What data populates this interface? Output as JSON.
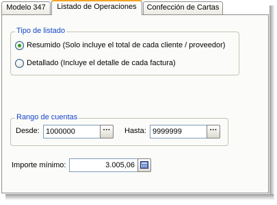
{
  "tabs": [
    {
      "label": "Modelo 347",
      "active": false
    },
    {
      "label": "Listado de Operaciones",
      "active": true
    },
    {
      "label": "Confección de Cartas",
      "active": false
    }
  ],
  "tipo_listado": {
    "title": "Tipo de listado",
    "options": [
      {
        "label": "Resumido (Solo incluye el total de cada cliente / proveedor)",
        "selected": true
      },
      {
        "label": "Detallado (Incluye el detalle de cada factura)",
        "selected": false
      }
    ]
  },
  "rango_cuentas": {
    "title": "Rango de cuentas",
    "desde_label": "Desde:",
    "desde_value": "1000000",
    "hasta_label": "Hasta:",
    "hasta_value": "9999999",
    "browse_label": "···"
  },
  "importe": {
    "label": "Importe mínimo:",
    "value": "3.005,06",
    "icon": "calculator-icon"
  },
  "colors": {
    "accent_tab": "#f5a321",
    "group_title": "#1545c8",
    "radio_dot": "#21a121"
  }
}
